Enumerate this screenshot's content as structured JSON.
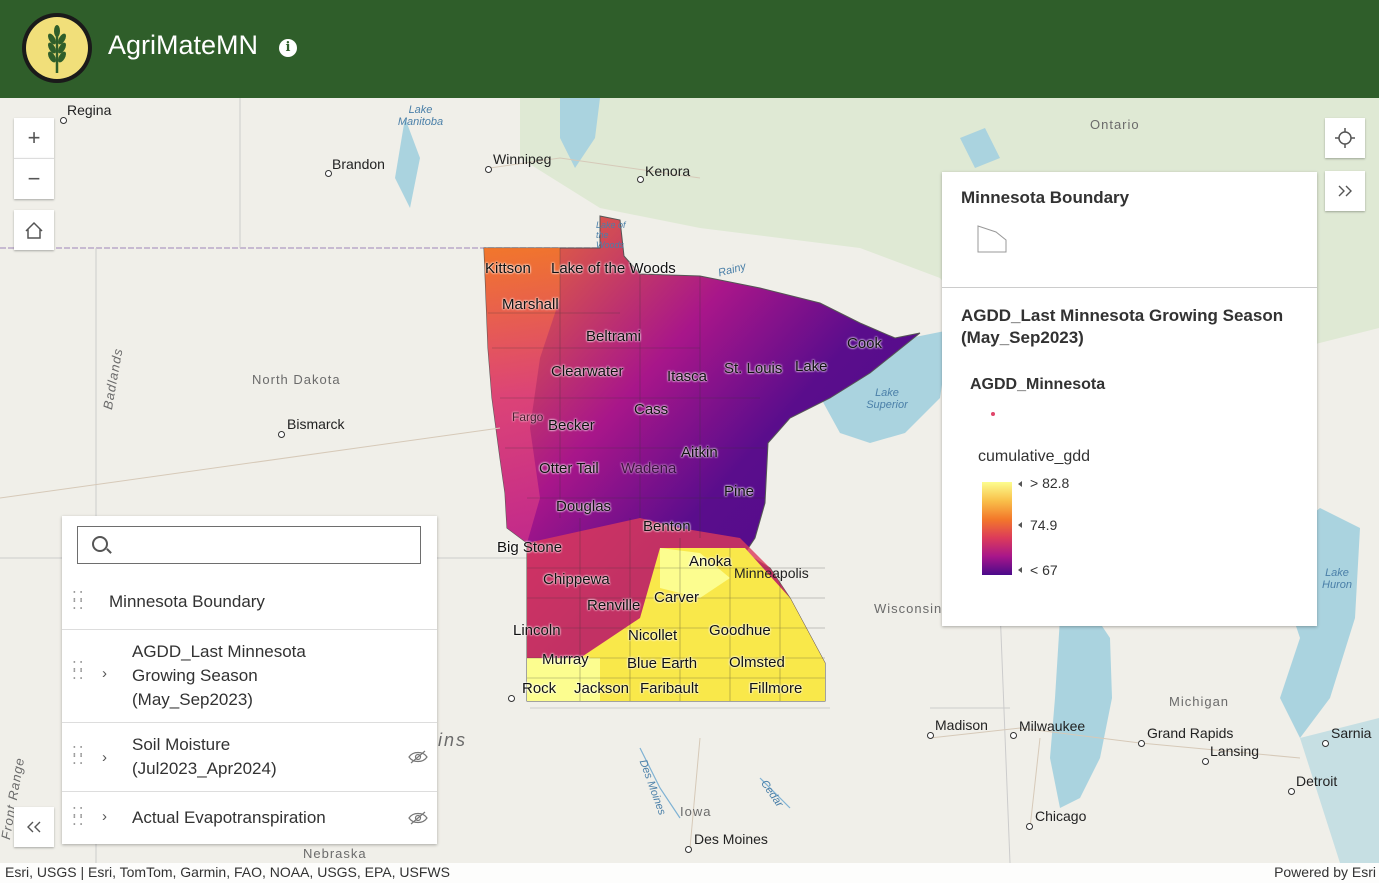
{
  "header": {
    "title": "AgriMateMN"
  },
  "map": {
    "cities": [
      {
        "name": "Regina"
      },
      {
        "name": "Brandon"
      },
      {
        "name": "Winnipeg"
      },
      {
        "name": "Kenora"
      },
      {
        "name": "Bismarck"
      },
      {
        "name": "Minneapolis"
      },
      {
        "name": "Madison"
      },
      {
        "name": "Milwaukee"
      },
      {
        "name": "Grand Rapids"
      },
      {
        "name": "Lansing"
      },
      {
        "name": "Detroit"
      },
      {
        "name": "Sarnia"
      },
      {
        "name": "Chicago"
      },
      {
        "name": "Des Moines"
      }
    ],
    "regions": {
      "ontario": "Ontario",
      "north_dakota": "North Dakota",
      "wisconsin": "Wisconsin",
      "michigan": "Michigan",
      "iowa": "Iowa",
      "nebraska": "Nebraska",
      "badlands": "Badlands",
      "front_range": "Front Range",
      "plains": "ins"
    },
    "water": {
      "lake_manitoba": "Lake Manitoba",
      "lake_superior": "Lake Superior",
      "lake_huron": "Lake Huron",
      "rainy": "Rainy",
      "des_moines_river": "Des Moines",
      "cedar": "Cedar",
      "lake_of_the_woods": "Lake of the Woods"
    },
    "counties": {
      "kittson": "Kittson",
      "lake_of_the_woods": "Lake of the Woods",
      "marshall": "Marshall",
      "beltrami": "Beltrami",
      "clearwater": "Clearwater",
      "itasca": "Itasca",
      "st_louis": "St. Louis",
      "lake": "Lake",
      "cook": "Cook",
      "becker": "Becker",
      "cass": "Cass",
      "aitkin": "Aitkin",
      "otter_tail": "Otter Tail",
      "pine": "Pine",
      "douglas": "Douglas",
      "benton": "Benton",
      "big_stone": "Big Stone",
      "anoka": "Anoka",
      "chippewa": "Chippewa",
      "renville": "Renville",
      "carver": "Carver",
      "lincoln": "Lincoln",
      "nicollet": "Nicollet",
      "goodhue": "Goodhue",
      "murray": "Murray",
      "blue_earth": "Blue Earth",
      "olmsted": "Olmsted",
      "rock": "Rock",
      "jackson": "Jackson",
      "faribault": "Faribault",
      "fillmore": "Fillmore",
      "fargo": "Fargo",
      "wadena": "Wadena"
    }
  },
  "controls": {
    "zoom_in": "+",
    "zoom_out": "−",
    "home": "⌂",
    "locate": "⌖",
    "expand": "»",
    "collapse": "«"
  },
  "legend": {
    "layer1_title": "Minnesota Boundary",
    "layer2_title": "AGDD_Last Minnesota Growing Season (May_Sep2023)",
    "sublayer": "AGDD_Minnesota",
    "field": "cumulative_gdd",
    "ramp_high": "> 82.8",
    "ramp_mid": "74.9",
    "ramp_low": "< 67",
    "ramp_colors": [
      "#fcfd8f",
      "#f9c04a",
      "#f3782a",
      "#dc3b5a",
      "#a8168a",
      "#4a0a8a"
    ]
  },
  "layer_list": {
    "search_placeholder": "",
    "items": [
      {
        "label": "Minnesota Boundary",
        "expandable": false,
        "visible": true
      },
      {
        "label_line1": "AGDD_Last Minnesota",
        "label_line2": "Growing Season",
        "label_line3": "(May_Sep2023)",
        "expandable": true,
        "visible": true
      },
      {
        "label_line1": "Soil Moisture",
        "label_line2": "(Jul2023_Apr2024)",
        "expandable": true,
        "visible": false
      },
      {
        "label": "Actual Evapotranspiration",
        "expandable": true,
        "visible": false
      }
    ]
  },
  "attribution": {
    "left": "Esri, USGS | Esri, TomTom, Garmin, FAO, NOAA, USGS, EPA, USFWS",
    "right": "Powered by Esri"
  }
}
